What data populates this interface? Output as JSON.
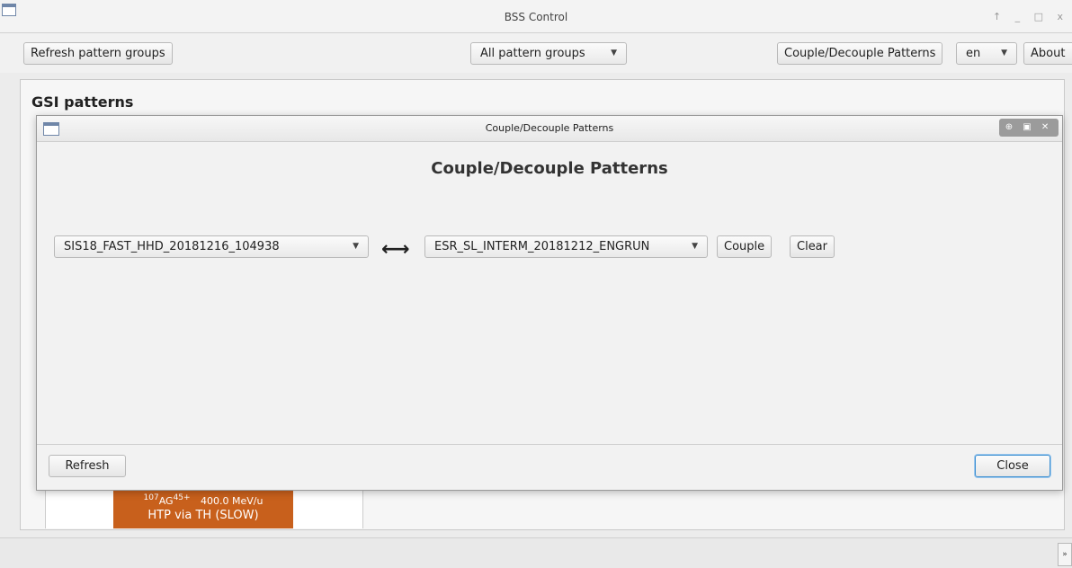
{
  "window": {
    "title": "BSS Control",
    "controls": "↑ _ □ x"
  },
  "toolbar": {
    "refresh_label": "Refresh pattern groups",
    "group_filter": "All pattern groups",
    "couple_label": "Couple/Decouple Patterns",
    "language": "en",
    "about_label": "About"
  },
  "main": {
    "section_title": "GSI patterns",
    "pattern": {
      "isotope_mass": "107",
      "element": "AG",
      "charge": "45+",
      "energy": "400.0 MeV/u",
      "name": "HTP via TH (SLOW)"
    }
  },
  "dialog": {
    "title": "Couple/Decouple Patterns",
    "controls": "⊕ ▣ ✕",
    "heading": "Couple/Decouple Patterns",
    "left_pattern": "SIS18_FAST_HHD_20181216_104938",
    "swap_symbol": "⟷",
    "right_pattern": "ESR_SL_INTERM_20181212_ENGRUN",
    "couple_label": "Couple",
    "clear_label": "Clear",
    "refresh_label": "Refresh",
    "close_label": "Close"
  },
  "statusbar": {
    "scroll_symbol": "»"
  },
  "colors": {
    "pattern_chip": "#c8601c",
    "focus_border": "#3d8fd1",
    "icon_frame": "#6f86a8"
  }
}
